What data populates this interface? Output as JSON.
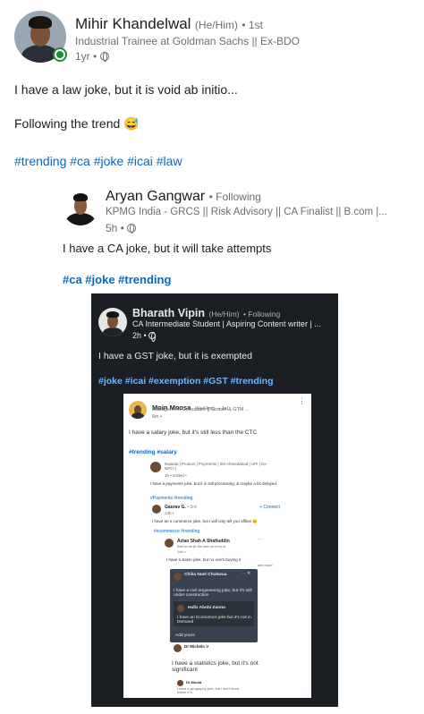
{
  "post": {
    "author": "Mihir Khandelwal",
    "pronouns": "(He/Him)",
    "degree": "• 1st",
    "headline": "Industrial Trainee at Goldman Sachs || Ex-BDO",
    "time": "1yr •",
    "line1": "I have a law joke, but it is void ab initio...",
    "line2": "Following the trend",
    "emoji": "😅",
    "hashtags": "#trending #ca #joke #icai #law"
  },
  "repost1": {
    "author": "Aryan Gangwar",
    "status": "• Following",
    "headline": "KPMG India - GRCS || Risk Advisory || CA Finalist || B.com |...",
    "time": "5h •",
    "text": "I have a CA joke, but it will take attempts",
    "hashtags": "#ca #joke #trending"
  },
  "repost2": {
    "author": "Bharath Vipin",
    "pronouns": "(He/Him)",
    "status": "• Following",
    "headline": "CA Intermediate Student | Aspiring Content writer | ...",
    "time": "2h •",
    "text": "I have a GST joke, but it is exempted",
    "hashtags": "#joke #icai #exemption #GST #trending"
  },
  "repost3": {
    "author": "Moin Moosa",
    "pronouns": "(He/Him)",
    "degree": "• 1st",
    "headline": "Management Consultant || Growth & GTM ...",
    "time": "6m •",
    "text": "I have a salary joke, but it's still less than the CTC",
    "hashtags": "#trending #salary"
  },
  "nested": {
    "n1_headline": "Nalaala | Product | Payments | IIM Ahmedabad | UPI | Ex-NPCI |",
    "n1_time": "1h • Edited •",
    "n1_text": "I have a payments joke, but it is still processing. & maybe a bit delayed.",
    "n1_tags": "#Payments #trending",
    "n2_author": "Gaurav G.",
    "n2_degree": "• 3rd",
    "n2_connect": "Connect",
    "n2_time": "14h •",
    "n2_text": "I have an e commerce joke, but I will only tell you offline 😉",
    "n2_tags": "#ecommerce #trending",
    "n3_author": "Azlan Shah A Shafiuddin",
    "n3_sub": "Bait ko aa jin the aam ai hi ho ni",
    "n3_time": "14m •",
    "n3_text": "I have a Salon joke, but no one's buying it",
    "see_more": "see more",
    "g1_author": "Chika Nuel Chukwua",
    "g1_text": "I have a civil engineering joke, but it's still under construction",
    "g2_author": "Hafiz Abobi Zannu",
    "g2_text": "I have an Economics joke but it's not in Demand",
    "add_yours": "Add yours",
    "n4_author": "Dr Michelo V",
    "n4_text": "I have a statistics joke, but it's not significant",
    "n5_author": "Dr Mould",
    "n5_text": "I have a geography joke, but I don't know where it is"
  }
}
